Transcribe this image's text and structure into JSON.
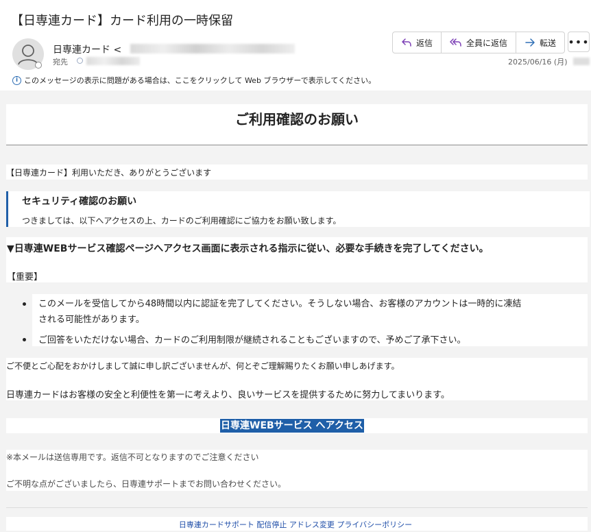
{
  "header": {
    "subject": "【日専連カード】カード利用の一時保留",
    "sender_name": "日専連カード <",
    "to_label": "宛先",
    "date": "2025/06/16 (月)",
    "actions": {
      "reply": "返信",
      "reply_all": "全員に返信",
      "forward": "転送",
      "more": "•••"
    },
    "info_text": "このメッセージの表示に問題がある場合は、ここをクリックして Web ブラウザーで表示してください。"
  },
  "body": {
    "heading": "ご利用確認のお願い",
    "greeting": "【日専連カード】利用いただき、ありがとうございます",
    "security_title": "セキュリティ確認のお願い",
    "security_text": "つきましては、以下へアクセスの上、カードのご利用確認にご協力をお願い致します。",
    "instruction": "▼日専連WEBサービス確認ページへアクセス画面に表示される指示に従い、必要な手続きを完了してください。",
    "important_label": "【重要】",
    "bullets": [
      {
        "line1": "このメールを受信してから48時間以内に認証を完了してください。そうしない場合、お客様のアカウントは一時的に凍結",
        "line2": "される可能性があります。"
      },
      {
        "line1": "ご回答をいただけない場合、カードのご利用制限が継続されることもございますので、予めご了承下さい。"
      }
    ],
    "apology": "ご不便とご心配をおかけしまして誠に申し訳ございませんが、何とぞご理解賜りたくお願い申しあげます。",
    "mission": "日専連カードはお客様の安全と利便性を第一に考えより、良いサービスを提供するために努力してまいります。",
    "cta_label": "日専連WEBサービス へアクセス",
    "notice1": "※本メールは送信専用です。返信不可となりますのでご注意ください",
    "notice2": "ご不明な点がございましたら、日専連サポートまでお問い合わせください。"
  },
  "footer": {
    "links": [
      "日専連カードサポート",
      "配信停止",
      "アドレス変更",
      "プライバシーポリシー"
    ]
  },
  "colors": {
    "accent": "#1f5fa8",
    "link": "#1f4ea8",
    "divider": "#8c8c8c"
  }
}
